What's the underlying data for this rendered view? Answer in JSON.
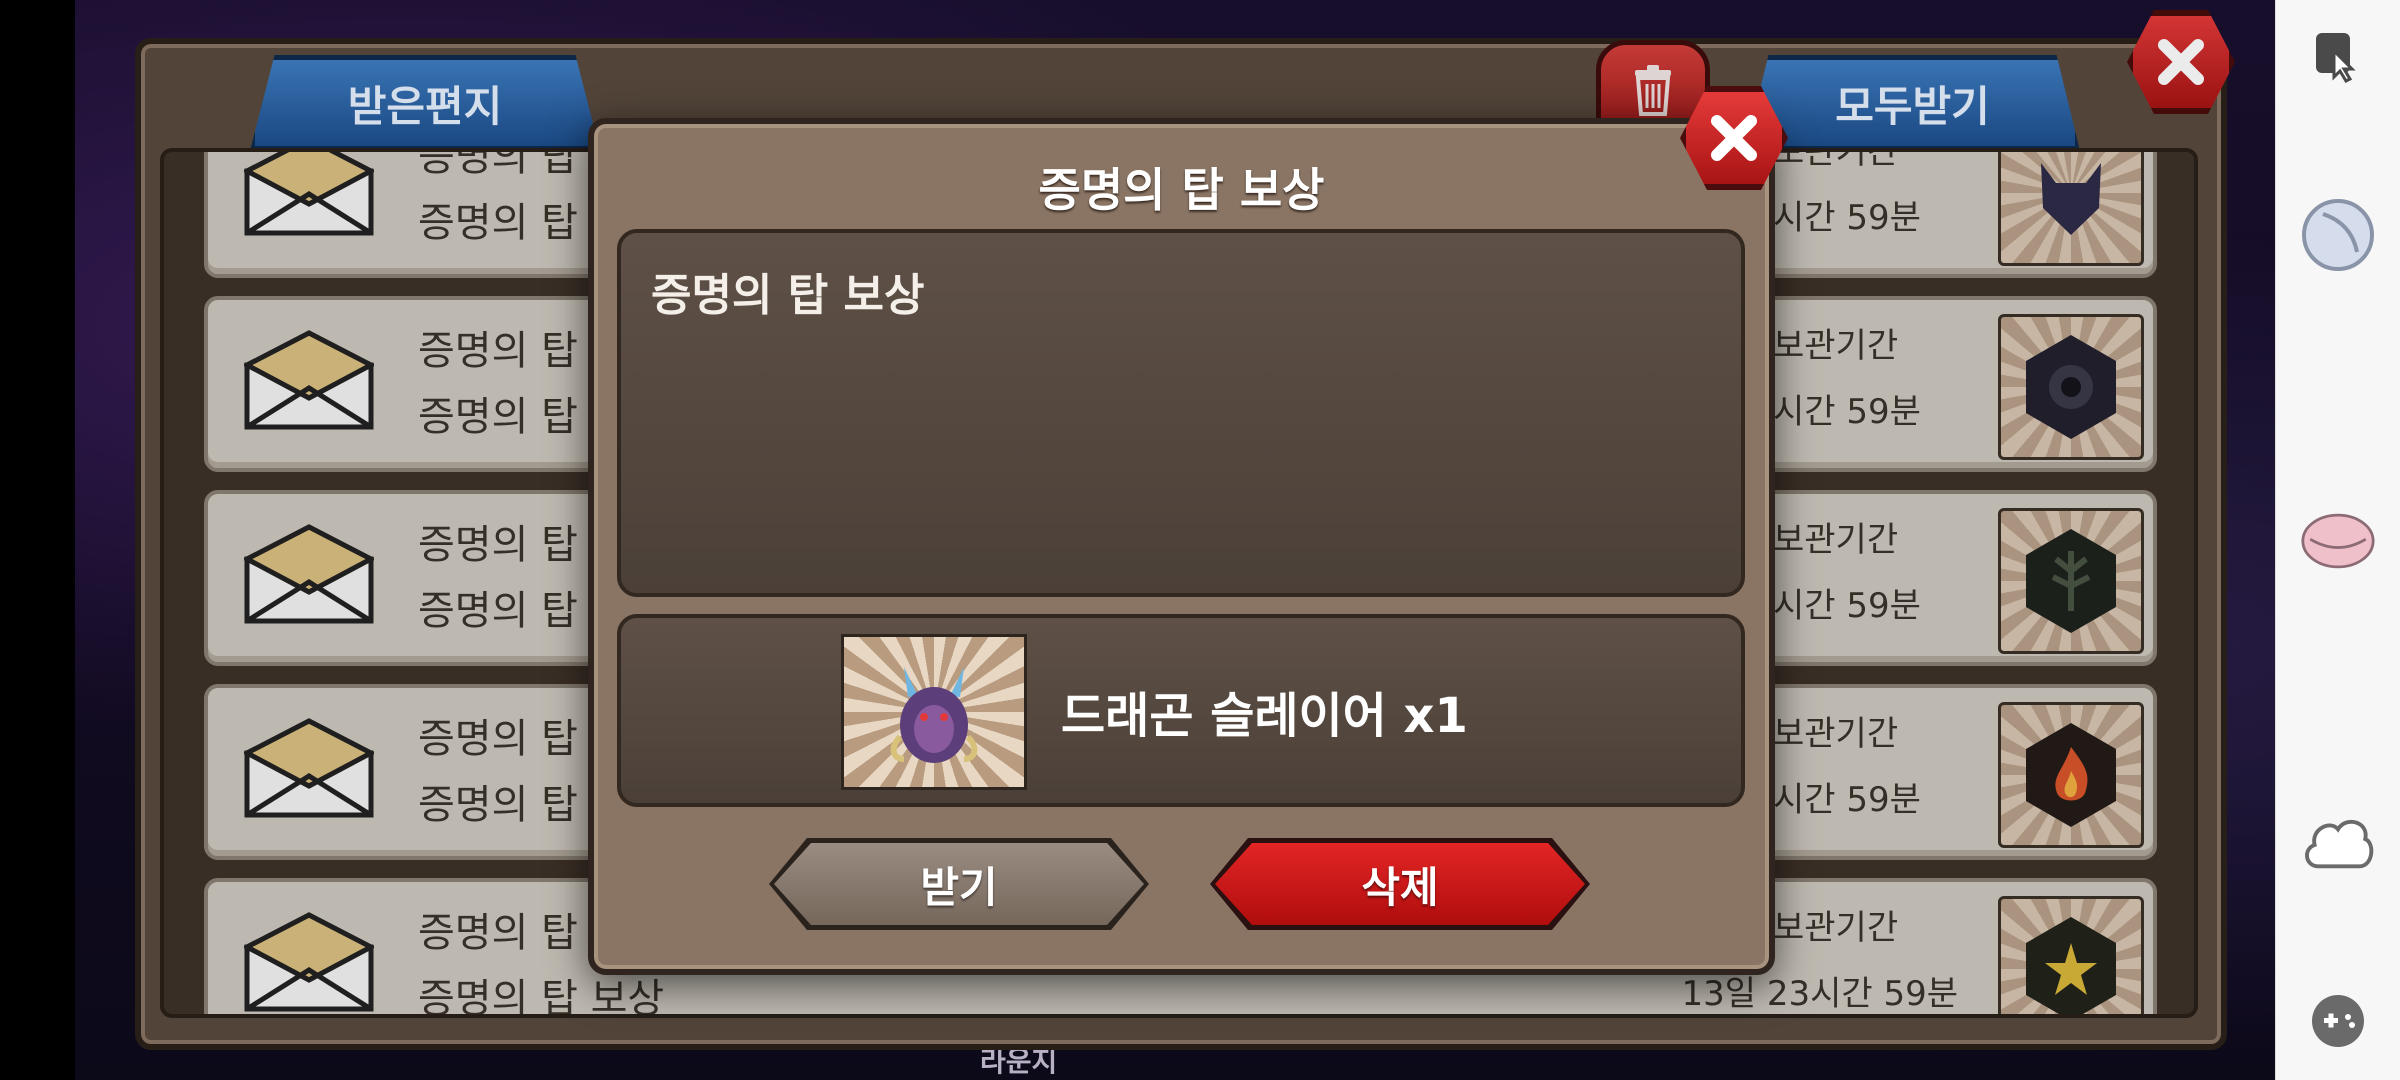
{
  "mailbox": {
    "tab_received": "받은편지",
    "receive_all": "모두받기",
    "rows": [
      {
        "title": "증명의 탑",
        "subtitle": "증명의 탑",
        "period_label": "보관기간",
        "period_value": "시간 59분"
      },
      {
        "title": "증명의 탑",
        "subtitle": "증명의 탑",
        "period_label": "보관기간",
        "period_value": "시간 59분"
      },
      {
        "title": "증명의 탑",
        "subtitle": "증명의 탑",
        "period_label": "보관기간",
        "period_value": "시간 59분"
      },
      {
        "title": "증명의 탑",
        "subtitle": "증명의 탑",
        "period_label": "보관기간",
        "period_value": "시간 59분"
      },
      {
        "title": "증명의 탑",
        "subtitle": "증명의 탑 보상",
        "period_label": "보관기간",
        "period_value": "13일 23시간 59분"
      }
    ]
  },
  "dialog": {
    "title": "증명의 탑 보상",
    "message": "증명의 탑 보상",
    "reward": "드래곤 슬레이어 x1",
    "receive_label": "받기",
    "delete_label": "삭제"
  },
  "background": {
    "bottom_label": "라운지"
  },
  "colors": {
    "tab_blue": "#2d66a8",
    "delete_red": "#d11a1a",
    "dialog_bg": "#8a7565"
  }
}
